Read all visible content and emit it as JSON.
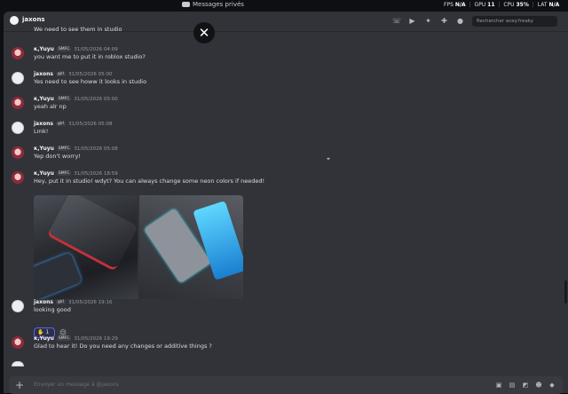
{
  "window": {
    "title": "Messages privés"
  },
  "stats": {
    "fps_label": "FPS",
    "fps_value": "N/A",
    "gpu_label": "GPU",
    "gpu_value": "11",
    "cpu_label": "CPU",
    "cpu_value": "35",
    "cpu_unit": "%",
    "lat_label": "LAT",
    "lat_value": "N/A"
  },
  "header": {
    "channel_name": "jaxons",
    "search_placeholder": "Rechercher acey.freaky"
  },
  "messages": [
    {
      "author": "κ,Yuyu",
      "tag": "SMFC",
      "time": "31/05/2026 04:09",
      "text": "you want me to put it in roblox studio?"
    },
    {
      "author": "jaxons",
      "tag": "girl",
      "time": "31/05/2026 05:00",
      "text": "Yes need to see howw it looks in studio"
    },
    {
      "author": "κ,Yuyu",
      "tag": "SMFC",
      "time": "31/05/2026 05:00",
      "text": "yeah alr np"
    },
    {
      "author": "jaxons",
      "tag": "girl",
      "time": "31/05/2026 05:08",
      "text": "Lmk!"
    },
    {
      "author": "κ,Yuyu",
      "tag": "SMFC",
      "time": "31/05/2026 05:08",
      "text": "Yep don't worry!"
    },
    {
      "author": "κ,Yuyu",
      "tag": "SMFC",
      "time": "31/05/2026 18:59",
      "text": "Hey, put it in studio! wdyt? You can always change some neon colors if needed!"
    },
    {
      "author": "jaxons",
      "tag": "girl",
      "time": "31/05/2026 19:16",
      "text": "looking good"
    },
    {
      "author": "κ,Yuyu",
      "tag": "SMFC",
      "time": "31/05/2026 19:29",
      "text": "Glad to hear it! Do you need any changes or additive things ?"
    }
  ],
  "top_partial_text": "We need to see them in studio",
  "reaction": {
    "emoji": "✋",
    "count": "1"
  },
  "composer": {
    "placeholder": "Envoyer un message à @jaxons"
  }
}
